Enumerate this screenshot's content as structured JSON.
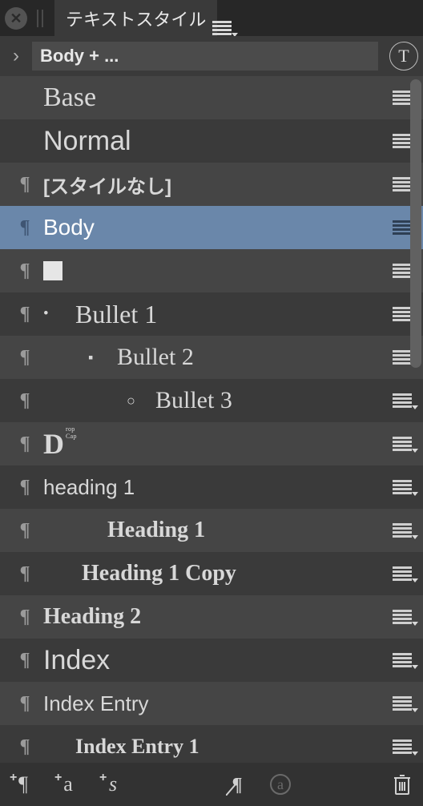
{
  "header": {
    "tab_title": "テキストスタイル"
  },
  "search": {
    "value": "Body + ..."
  },
  "tbadge": "T",
  "styles": [
    {
      "id": "base",
      "label": "Base",
      "font": "georgia",
      "showPara": false,
      "shade": "light",
      "indent": 0,
      "selected": false,
      "size": 34
    },
    {
      "id": "normal",
      "label": "Normal",
      "font": "opt",
      "showPara": false,
      "shade": "dark",
      "indent": 0,
      "selected": false,
      "size": 34
    },
    {
      "id": "nostyle",
      "label": "[スタイルなし]",
      "font": "sans-bold",
      "showPara": true,
      "shade": "light",
      "indent": 0,
      "selected": false,
      "size": 24
    },
    {
      "id": "body",
      "label": "Body",
      "font": "opt",
      "showPara": true,
      "shade": "selected",
      "indent": 0,
      "selected": true,
      "size": 28
    },
    {
      "id": "swatch",
      "label": "",
      "font": "swatch",
      "showPara": true,
      "shade": "light",
      "indent": 0,
      "selected": false,
      "size": 24
    },
    {
      "id": "bullet1",
      "label": "Bullet 1",
      "prefix": "•",
      "font": "georgia",
      "showPara": true,
      "shade": "dark",
      "indent": 0,
      "selected": false,
      "size": 32,
      "bulletGap": 40
    },
    {
      "id": "bullet2",
      "label": "Bullet 2",
      "prefix": "▪",
      "font": "georgia",
      "showPara": true,
      "shade": "light",
      "indent": 56,
      "selected": false,
      "size": 30,
      "bulletGap": 36
    },
    {
      "id": "bullet3",
      "label": "Bullet 3",
      "prefix": "○",
      "font": "georgia",
      "showPara": true,
      "shade": "dark",
      "indent": 104,
      "selected": false,
      "size": 30,
      "bulletGap": 36
    },
    {
      "id": "dropcap",
      "label": "D",
      "sup": "rop Cap",
      "font": "dropcap",
      "showPara": true,
      "shade": "light",
      "indent": 0,
      "selected": false,
      "size": 36
    },
    {
      "id": "heading1a",
      "label": "heading 1",
      "font": "sans",
      "showPara": true,
      "shade": "dark",
      "indent": 0,
      "selected": false,
      "size": 26
    },
    {
      "id": "heading1b",
      "label": "Heading 1",
      "font": "georgia-bold",
      "showPara": true,
      "shade": "light",
      "indent": 80,
      "selected": false,
      "size": 28
    },
    {
      "id": "heading1copy",
      "label": "Heading 1 Copy",
      "font": "georgia-bold",
      "showPara": true,
      "shade": "dark",
      "indent": 48,
      "selected": false,
      "size": 28
    },
    {
      "id": "heading2",
      "label": "Heading 2",
      "font": "georgia-bold",
      "showPara": true,
      "shade": "light",
      "indent": 0,
      "selected": false,
      "size": 28
    },
    {
      "id": "index",
      "label": "Index",
      "font": "opt",
      "showPara": true,
      "shade": "dark",
      "indent": 0,
      "selected": false,
      "size": 34
    },
    {
      "id": "indexentry",
      "label": "Index Entry",
      "font": "opt",
      "showPara": true,
      "shade": "light",
      "indent": 0,
      "selected": false,
      "size": 26
    },
    {
      "id": "indexentry1",
      "label": "Index Entry 1",
      "font": "georgia-bold",
      "showPara": true,
      "shade": "dark",
      "indent": 40,
      "selected": false,
      "size": 26
    }
  ],
  "plus": "+",
  "para_mark": "¶",
  "glyph_a": "a",
  "glyph_s": "s"
}
